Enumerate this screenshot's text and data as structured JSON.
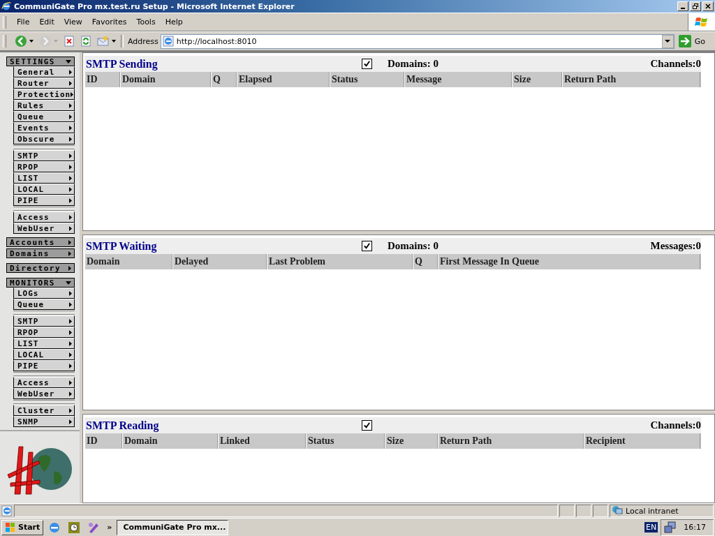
{
  "window": {
    "title": "CommuniGate Pro mx.test.ru Setup - Microsoft Internet Explorer"
  },
  "menu_bar": [
    "File",
    "Edit",
    "View",
    "Favorites",
    "Tools",
    "Help"
  ],
  "toolbar": [
    {
      "kind": "back",
      "disabled": false
    },
    {
      "kind": "forward",
      "disabled": true
    },
    {
      "kind": "stop"
    },
    {
      "kind": "refresh"
    },
    {
      "kind": "mail"
    }
  ],
  "address_bar": {
    "label": "Address",
    "value": "http://localhost:8010",
    "go_label": "Go"
  },
  "sidebar": [
    {
      "kind": "menu",
      "label": "SETTINGS",
      "expanded": true,
      "groups": [
        [
          "General",
          "Router",
          "Protection",
          "Rules",
          "Queue",
          "Events",
          "Obscure"
        ],
        [
          "SMTP",
          "RPOP",
          "LIST",
          "LOCAL",
          "PIPE"
        ],
        [
          "Access",
          "WebUser"
        ]
      ]
    },
    {
      "kind": "links",
      "items": [
        "Accounts",
        "Domains"
      ]
    },
    {
      "kind": "links",
      "items": [
        "Directory"
      ]
    },
    {
      "kind": "menu",
      "label": "MONITORS",
      "expanded": true,
      "groups": [
        [
          "LOGs",
          "Queue"
        ],
        [
          "SMTP",
          "RPOP",
          "LIST",
          "LOCAL",
          "PIPE"
        ],
        [
          "Access",
          "WebUser"
        ],
        [
          "Cluster",
          "SNMP"
        ]
      ]
    }
  ],
  "panes": [
    {
      "title": "SMTP Sending",
      "checked": true,
      "domains": "Domains: 0",
      "count": "Channels:0",
      "columns": [
        "ID",
        "Domain",
        "Q",
        "Elapsed",
        "Status",
        "Message",
        "Size",
        "Return Path"
      ]
    },
    {
      "title": "SMTP Waiting",
      "checked": true,
      "domains": "Domains: 0",
      "count": "Messages:0",
      "columns": [
        "Domain",
        "Delayed",
        "Last Problem",
        "Q",
        "First Message In Queue"
      ]
    },
    {
      "title": "SMTP Reading",
      "checked": true,
      "count": "Channels:0",
      "columns": [
        "ID",
        "Domain",
        "Linked",
        "Status",
        "Size",
        "Return Path",
        "Recipient"
      ]
    }
  ],
  "status_bar": {
    "zone": "Local intranet"
  },
  "taskbar": {
    "start": "Start",
    "overflow": "»",
    "tasks": [
      {
        "label": "CommuniGate Pro mx...",
        "selected": true
      }
    ],
    "language": "EN",
    "clock": "16:17"
  }
}
